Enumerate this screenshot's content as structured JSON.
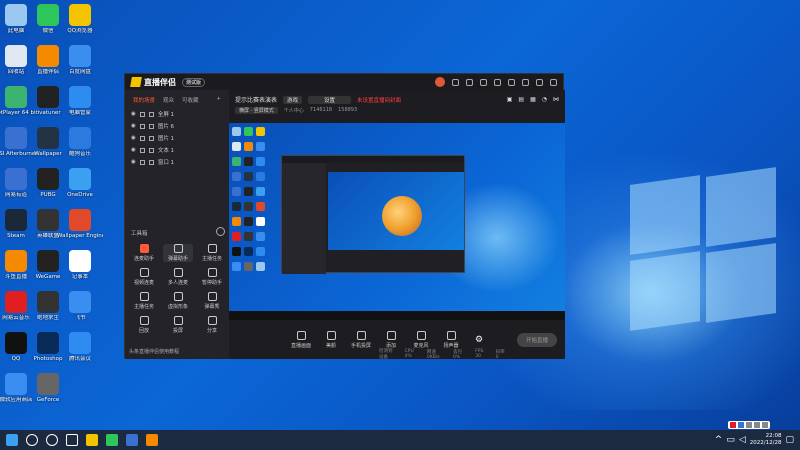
{
  "desktop": {
    "icons": [
      {
        "label": "此电脑",
        "color": "#9bc8f0"
      },
      {
        "label": "微信",
        "color": "#2ec65a"
      },
      {
        "label": "QQ浏览器",
        "color": "#f5c400"
      },
      {
        "label": "回收站",
        "color": "#dfe8f0"
      },
      {
        "label": "直播伴侣",
        "color": "#f58a00"
      },
      {
        "label": "百度网盘",
        "color": "#3a8ef0"
      },
      {
        "label": "PotPlayer 64 bit",
        "color": "#3cb371"
      },
      {
        "label": "rivatuner",
        "color": "#222222"
      },
      {
        "label": "电脑管家",
        "color": "#2e8bf0"
      },
      {
        "label": "MSI Afterburner",
        "color": "#3a70d0"
      },
      {
        "label": "Wallpaper",
        "color": "#223344"
      },
      {
        "label": "酷狗音乐",
        "color": "#2a7ae0"
      },
      {
        "label": "网易有道",
        "color": "#3a70d0"
      },
      {
        "label": "PUBG",
        "color": "#222222"
      },
      {
        "label": "OneDrive",
        "color": "#3aa0f0"
      },
      {
        "label": "Steam",
        "color": "#1b2838"
      },
      {
        "label": "英雄联盟",
        "color": "#333333"
      },
      {
        "label": "Wallpaper Engine",
        "color": "#e04a2a"
      },
      {
        "label": "斗鱼直播",
        "color": "#f58a00"
      },
      {
        "label": "WeGame",
        "color": "#222222"
      },
      {
        "label": "记事本",
        "color": "#ffffff"
      },
      {
        "label": "网易云音乐",
        "color": "#e02020"
      },
      {
        "label": "绝地求生",
        "color": "#333333"
      },
      {
        "label": "飞书",
        "color": "#3a8ef0"
      },
      {
        "label": "QQ",
        "color": "#111111"
      },
      {
        "label": "Photoshop",
        "color": "#0a2a5a"
      },
      {
        "label": "腾讯会议",
        "color": "#2e8bf0"
      },
      {
        "label": "微软应用商店",
        "color": "#3a8ef0"
      },
      {
        "label": "GeForce",
        "color": "#666666"
      }
    ]
  },
  "app": {
    "title": "直播伴侣",
    "version": "测试版",
    "tabs": [
      "我的场景",
      "观众",
      "可收藏"
    ],
    "layers": [
      "全屏 1",
      "图片 6",
      "图片 1",
      "文本 1",
      "窗口 1"
    ],
    "tools_header": "工具箱",
    "tools": [
      "连麦助手",
      "弹幕助手",
      "主播任务",
      "视频连麦",
      "多人连麦",
      "暂停助手",
      "主播任务",
      "虚拟形象",
      "弹幕秀",
      "回放",
      "投屏",
      "分享"
    ],
    "tips": "头条直播伴侣使用教程",
    "header": {
      "title": "提示比赛表演表",
      "tag": "游戏",
      "select": "设置",
      "warn": "未设置直播间封面"
    },
    "subheader": {
      "pill": "横屏 · 竖屏模式",
      "viewers": "个人中心",
      "uid": "7146118",
      "fans": "158893"
    },
    "controls": [
      "直播画面",
      "美颜",
      "手机投屏",
      "添加",
      "麦克风",
      "扬声器"
    ],
    "start_button": "开始直播",
    "status": [
      "检测到设备",
      "CPU 4%",
      "网速 0KB/s",
      "丢包 0%",
      "FPS 30",
      "码率 0"
    ]
  },
  "taskbar": {
    "time": "22:08",
    "date": "2022/12/28"
  }
}
